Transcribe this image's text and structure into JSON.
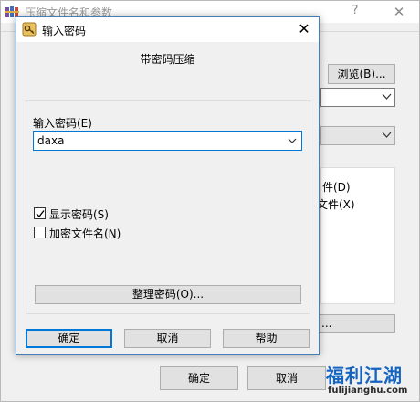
{
  "parent_window": {
    "title": "压缩文件名和参数",
    "help_glyph": "?",
    "close_glyph": "✕",
    "browse_label": "浏览(B)...",
    "option_1": "件(D)",
    "option_2": "文件(X)",
    "ellipsis_label": "...",
    "ok_label": "确定",
    "cancel_label": "取消"
  },
  "password_dialog": {
    "title": "输入密码",
    "close_glyph": "✕",
    "header": "带密码压缩",
    "field_label": "输入密码(E)",
    "password_value": "daxa",
    "checkboxes": [
      {
        "label": "显示密码(S)",
        "checked": true
      },
      {
        "label": "加密文件名(N)",
        "checked": false
      }
    ],
    "manage_label": "整理密码(O)...",
    "ok_label": "确定",
    "cancel_label": "取消",
    "help_label": "帮助"
  },
  "watermark": {
    "main": "福利江湖",
    "sub": "fulijianghu.com"
  },
  "icons": {
    "app_icon": "winrar-books-icon",
    "key_icon": "key-icon",
    "dropdown": "chevron-down-icon",
    "check": "checkmark-icon"
  },
  "colors": {
    "focus_blue": "#0078d7",
    "dialog_bg": "#f0f0f0",
    "button_bg": "#e1e1e1",
    "watermark_blue": "#1565c0"
  }
}
